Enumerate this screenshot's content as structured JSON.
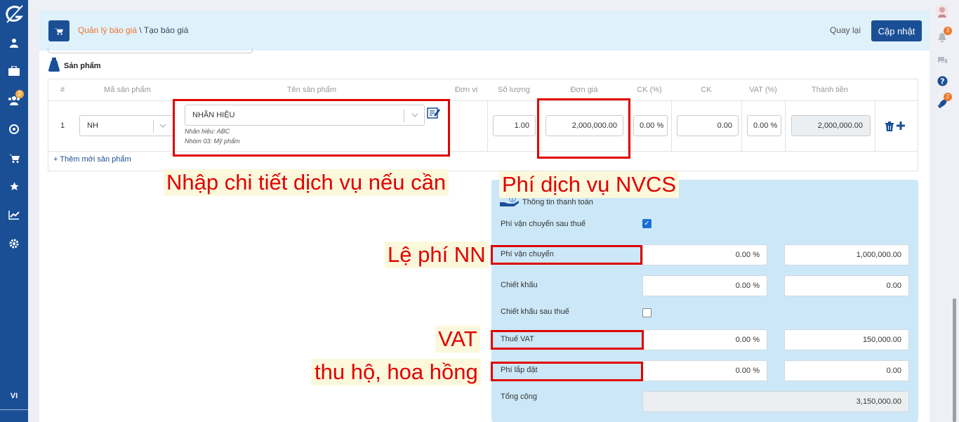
{
  "sidebar": {
    "lang": "VI",
    "badges": {
      "users": "2"
    }
  },
  "rightbar": {
    "badges": {
      "bell": "3",
      "rocket": "2"
    }
  },
  "header": {
    "crumb_1": "Quản lý báo giá",
    "crumb_sep": " \\ ",
    "crumb_2": "Tạo báo giá",
    "back_label": "Quay lại",
    "update_label": "Cập nhật"
  },
  "section": {
    "title": "Sản phẩm"
  },
  "table": {
    "columns": [
      "#",
      "Mã sản phẩm",
      "Tên sản phẩm",
      "Đơn vị",
      "Số lượng",
      "Đơn giá",
      "CK (%)",
      "CK",
      "VAT (%)",
      "Thành tiền"
    ],
    "row": {
      "index": "1",
      "code": "NH",
      "name": "NHÃN HIỆU",
      "detail_1": "Nhãn hiệu: ABC",
      "detail_2": "Nhóm 03: Mỹ phẩm",
      "qty": "1.00",
      "price": "2,000,000.00",
      "ck_pct": "0.00 %",
      "ck": "0.00",
      "vat_pct": "0.00 %",
      "total": "2,000,000.00"
    },
    "add_new": "+ Thêm mới sản phẩm"
  },
  "payment": {
    "title": "Thông tin thanh toán",
    "shipping_after_tax_label": "Phí vận chuyển sau thuế",
    "shipping_label": "Phí vận chuyển",
    "shipping_pct": "0.00 %",
    "shipping_value": "1,000,000.00",
    "discount_label": "Chiết khấu",
    "discount_pct": "0.00 %",
    "discount_value": "0.00",
    "discount_after_tax_label": "Chiết khấu sau thuế",
    "vat_label": "Thuế VAT",
    "vat_pct": "0.00 %",
    "vat_value": "150,000.00",
    "install_label": "Phí lắp đặt",
    "install_pct": "0.00 %",
    "install_value": "0.00",
    "total_label": "Tổng cộng",
    "total_value": "3,150,000.00"
  },
  "callouts": {
    "details": "Nhập chi tiết dịch vụ nếu cần",
    "nvcs": "Phí dịch vụ NVCS",
    "le_phi": "Lệ phí NN",
    "vat": "VAT",
    "thu_ho": "thu hộ, hoa hồng"
  },
  "colors": {
    "sidebar": "#1a4f95",
    "accent_orange": "#f0762b",
    "annotation_red": "#e00000",
    "payment_bg": "#cce8f8"
  }
}
